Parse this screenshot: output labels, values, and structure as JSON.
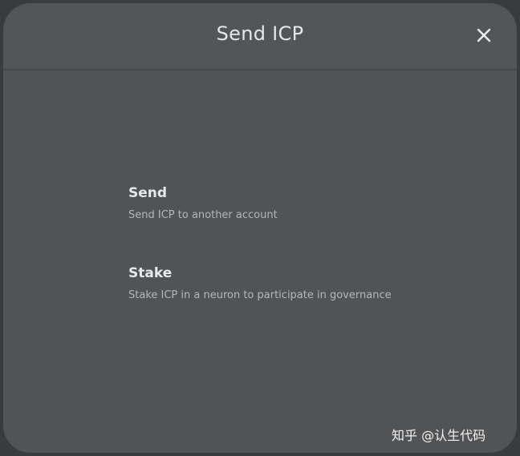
{
  "modal": {
    "title": "Send ICP",
    "close_icon": "close-x-icon"
  },
  "options": [
    {
      "title": "Send",
      "description": "Send ICP to another account"
    },
    {
      "title": "Stake",
      "description": "Stake ICP in a neuron to participate in governance"
    }
  ],
  "watermark": {
    "text": "知乎 @认生代码"
  },
  "colors": {
    "modal_background": "#525355",
    "page_background": "#3a3b3d",
    "title_text": "#e4e6e9",
    "secondary_text": "#b3b6ba"
  }
}
